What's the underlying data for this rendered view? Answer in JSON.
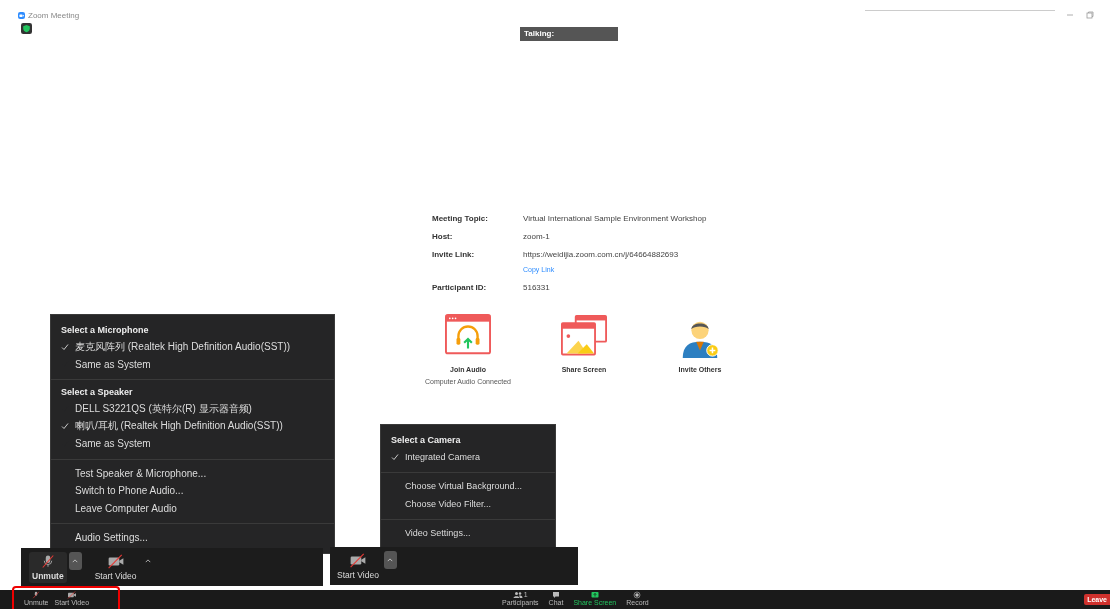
{
  "window": {
    "title": "Zoom Meeting"
  },
  "talking_indicator": {
    "label": "Talking:"
  },
  "meeting_info": {
    "rows": [
      {
        "label": "Meeting Topic:",
        "value": "Virtual International Sample Environment Workshop"
      },
      {
        "label": "Host:",
        "value": "zoom-1"
      },
      {
        "label": "Invite Link:",
        "value": "https://weidijia.zoom.com.cn/j/64664882693",
        "link": "Copy Link"
      },
      {
        "label": "Participant ID:",
        "value": "516331"
      }
    ]
  },
  "actions": [
    {
      "kind": "audio",
      "label": "Join Audio",
      "status": "Computer Audio Connected"
    },
    {
      "kind": "share",
      "label": "Share Screen"
    },
    {
      "kind": "invite",
      "label": "Invite Others"
    }
  ],
  "audio_menu": {
    "sections": [
      {
        "heading": "Select a Microphone",
        "items": [
          {
            "label": "麦克风阵列 (Realtek High Definition Audio(SST))",
            "selected": true
          },
          {
            "label": "Same as System",
            "selected": false
          }
        ]
      },
      {
        "heading": "Select a Speaker",
        "items": [
          {
            "label": "DELL S3221QS (英特尔(R) 显示器音频)",
            "selected": false
          },
          {
            "label": "喇叭/耳机 (Realtek High Definition Audio(SST))",
            "selected": true
          },
          {
            "label": "Same as System",
            "selected": false
          }
        ]
      },
      {
        "items": [
          {
            "label": "Test Speaker & Microphone..."
          },
          {
            "label": "Switch to Phone Audio..."
          },
          {
            "label": "Leave Computer Audio"
          }
        ]
      },
      {
        "items": [
          {
            "label": "Audio Settings..."
          }
        ]
      }
    ]
  },
  "audio_controls": {
    "mic_label": "Unmute",
    "video_label": "Start Video"
  },
  "video_menu": {
    "sections": [
      {
        "heading": "Select a Camera",
        "items": [
          {
            "label": "Integrated Camera",
            "selected": true
          }
        ]
      },
      {
        "items": [
          {
            "label": "Choose Virtual Background..."
          },
          {
            "label": "Choose Video Filter..."
          }
        ]
      },
      {
        "items": [
          {
            "label": "Video Settings..."
          }
        ]
      }
    ]
  },
  "video_controls": {
    "video_label": "Start Video"
  },
  "toolbar": {
    "left": [
      {
        "kind": "mic",
        "label": "Unmute"
      },
      {
        "kind": "video",
        "label": "Start Video"
      }
    ],
    "center": [
      {
        "kind": "participants",
        "label": "Participants",
        "count": "1"
      },
      {
        "kind": "chat",
        "label": "Chat"
      },
      {
        "kind": "share",
        "label": "Share Screen"
      },
      {
        "kind": "record",
        "label": "Record"
      }
    ],
    "leave": "Leave"
  }
}
